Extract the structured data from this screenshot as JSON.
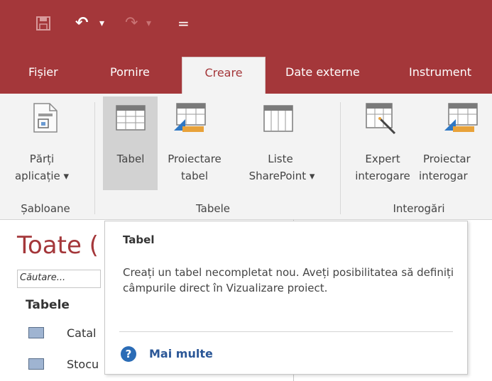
{
  "window": {
    "accent_color": "#a4373a"
  },
  "quick_access": {
    "save_icon": "save-icon",
    "undo_icon": "undo-icon",
    "redo_icon": "redo-icon",
    "customize_icon": "customize-icon",
    "undo_glyph": "↶",
    "undo_dropdown": "▾",
    "redo_glyph": "↷",
    "redo_dropdown": "▾",
    "customize_glyph": "="
  },
  "tabs": [
    {
      "label": "Fișier"
    },
    {
      "label": "Pornire"
    },
    {
      "label": "Creare",
      "active": true
    },
    {
      "label": "Date externe"
    },
    {
      "label": "Instrument"
    }
  ],
  "ribbon": {
    "groups": [
      {
        "label": "Șabloane",
        "buttons": [
          {
            "line1": "Părți",
            "line2": "aplicație ▾",
            "icon": "application-parts-icon"
          }
        ]
      },
      {
        "label": "Tabele",
        "buttons": [
          {
            "line1": "Tabel",
            "line2": "",
            "icon": "table-icon"
          },
          {
            "line1": "Proiectare",
            "line2": "tabel",
            "icon": "table-design-icon"
          },
          {
            "line1": "Liste",
            "line2": "SharePoint ▾",
            "icon": "sharepoint-lists-icon"
          }
        ]
      },
      {
        "label": "Interogări",
        "buttons": [
          {
            "line1": "Expert",
            "line2": "interogare",
            "icon": "query-wizard-icon"
          },
          {
            "line1": "Proiectar",
            "line2": "interogar",
            "icon": "query-design-icon"
          }
        ]
      }
    ]
  },
  "nav_pane": {
    "title": "Toate (",
    "search_placeholder": "Căutare...",
    "section": "Tabele",
    "items": [
      {
        "label": "Catal",
        "icon": "table-icon"
      },
      {
        "label": "Stocu",
        "icon": "table-icon"
      }
    ]
  },
  "tooltip": {
    "title": "Tabel",
    "body": "Creați un tabel necompletat nou. Aveți posibilitatea să definiți câmpurile direct în Vizualizare proiect.",
    "more_label": "Mai multe",
    "more_icon": "help-icon",
    "more_glyph": "?"
  }
}
